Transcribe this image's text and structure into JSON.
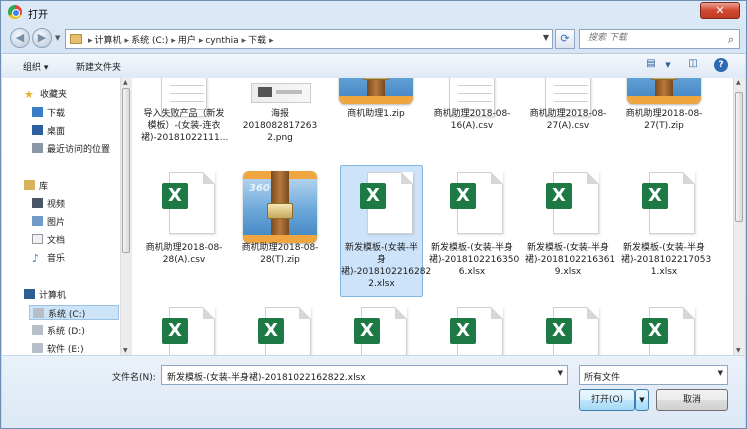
{
  "window": {
    "title": "打开",
    "close_label": "✕"
  },
  "nav": {
    "back_icon": "back-arrow",
    "forward_icon": "forward-arrow",
    "breadcrumbs": [
      "计算机",
      "系统 (C:)",
      "用户",
      "cynthia",
      "下载"
    ],
    "search_placeholder": "搜索 下载"
  },
  "toolbar": {
    "organize_label": "组织 ▾",
    "new_folder_label": "新建文件夹"
  },
  "sidebar": {
    "favorites_header": "收藏夹",
    "favorites": [
      "下载",
      "桌面",
      "最近访问的位置"
    ],
    "libraries_header": "库",
    "libraries": [
      "视频",
      "图片",
      "文档",
      "音乐"
    ],
    "computer_header": "计算机",
    "drives": [
      "系统 (C:)",
      "系统 (D:)",
      "软件 (E:)"
    ]
  },
  "files": {
    "row1": [
      {
        "label": "导入失败产品（新发模板）-(女装-连衣裙)-20181022111...",
        "kind": "csv"
      },
      {
        "label": "海报2018082817263 2.png",
        "kind": "png"
      },
      {
        "label": "商机助理1.zip",
        "kind": "zip"
      },
      {
        "label": "商机助理2018-08-16(A).csv",
        "kind": "csv"
      },
      {
        "label": "商机助理2018-08-27(A).csv",
        "kind": "csv"
      },
      {
        "label": "商机助理2018-08-27(T).zip",
        "kind": "zip"
      }
    ],
    "row2": [
      {
        "label": "商机助理2018-08-28(A).csv",
        "kind": "xlsx"
      },
      {
        "label": "商机助理2018-08-28(T).zip",
        "kind": "zip"
      },
      {
        "label": "新发模板-(女装-半身裙)-2018102216282 2.xlsx",
        "kind": "xlsx"
      },
      {
        "label": "新发模板-(女装-半身裙)-2018102216350 6.xlsx",
        "kind": "xlsx"
      },
      {
        "label": "新发模板-(女装-半身裙)-2018102216361 9.xlsx",
        "kind": "xlsx"
      },
      {
        "label": "新发模板-(女装-半身裙)-2018102217053 1.xlsx",
        "kind": "xlsx"
      }
    ]
  },
  "bottom": {
    "filename_label": "文件名(N):",
    "filename_value": "新发模板-(女装-半身裙)-20181022162822.xlsx",
    "filetype_value": "所有文件",
    "open_label": "打开(O)",
    "cancel_label": "取消"
  }
}
